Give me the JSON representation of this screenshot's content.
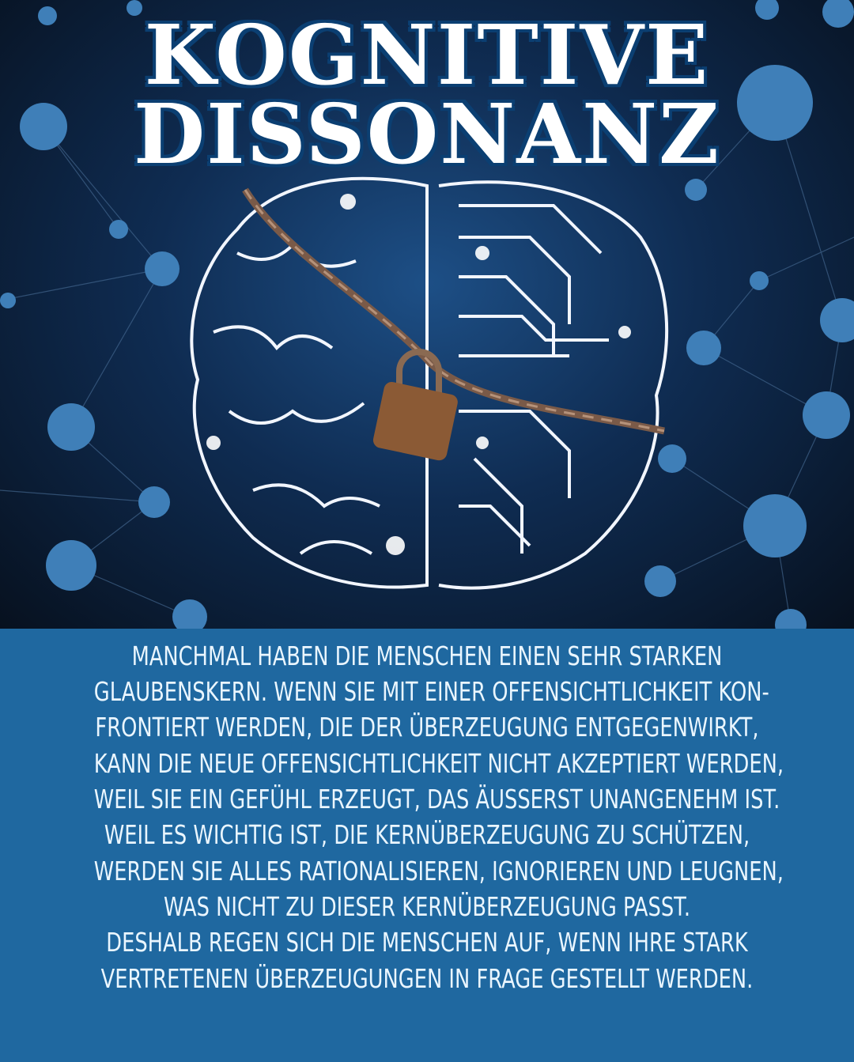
{
  "title": {
    "line1": "KOGNITIVE",
    "line2": "DISSONANZ"
  },
  "body_lines": [
    "MANCHMAL HABEN DIE MENSCHEN EINEN SEHR STARKEN",
    "GLAUBENSKERN. WENN SIE MIT EINER OFFENSICHTLICHKEIT KON-",
    "FRONTIERT WERDEN, DIE DER ÜBERZEUGUNG ENTGEGENWIRKT,",
    "KANN DIE NEUE OFFENSICHTLICHKEIT NICHT AKZEPTIERT WERDEN,",
    "WEIL SIE EIN GEFÜHL ERZEUGT, DAS ÄUSSERST UNANGENEHM IST.",
    "WEIL ES WICHTIG IST, DIE KERNÜBERZEUGUNG ZU SCHÜTZEN,",
    "WERDEN SIE ALLES RATIONALISIEREN, IGNORIEREN UND LEUGNEN,",
    "WAS NICHT ZU DIESER KERNÜBERZEUGUNG PASST.",
    "DESHALB REGEN SICH DIE MENSCHEN AUF, WENN IHRE STARK",
    "VERTRETENEN ÜBERZEUGUNGEN IN FRAGE GESTELLT WERDEN."
  ],
  "colors": {
    "panel": "#1f68a0",
    "node": "#3f7fb8",
    "text": "#eaf6ff"
  }
}
